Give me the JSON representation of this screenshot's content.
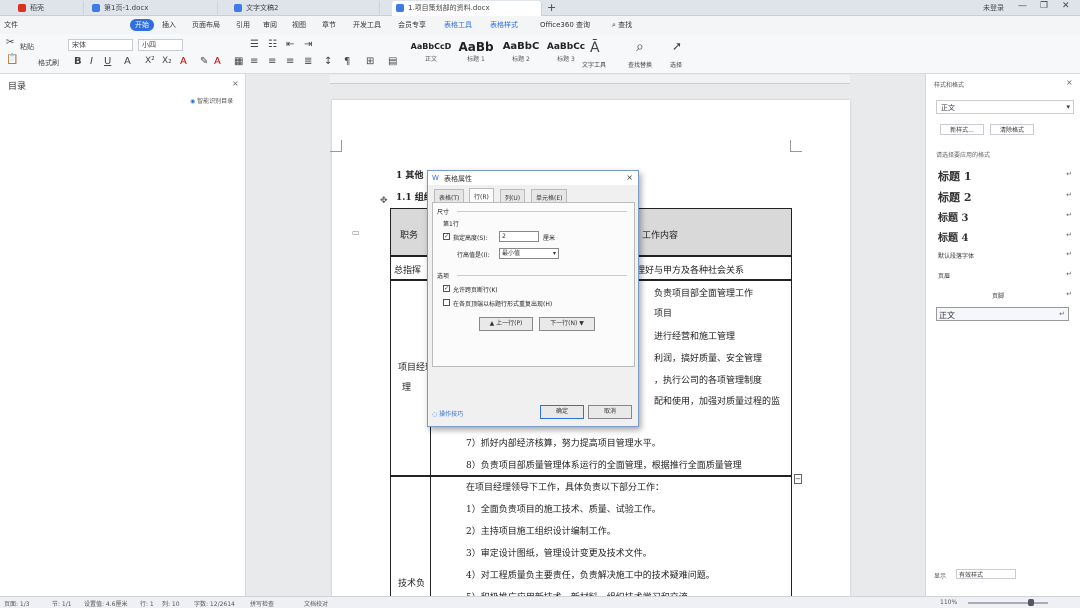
{
  "tabs": [
    {
      "label": "稻壳",
      "color": "#d9321f"
    },
    {
      "label": "第1页-1.docx",
      "color": "#3f7be5"
    },
    {
      "label": "文字文稿2",
      "color": "#3f7be5"
    },
    {
      "label": "1.项目策划部的资料.docx",
      "color": "#3f7be5"
    }
  ],
  "titlebar_right": {
    "login": "未登录",
    "share": "分享"
  },
  "menu": [
    "文件",
    "开始",
    "插入",
    "页面布局",
    "引用",
    "审阅",
    "视图",
    "章节",
    "开发工具",
    "会员专享",
    "表格工具",
    "表格样式",
    "Office360 查询",
    "查找"
  ],
  "menu_highlight": "开始",
  "toolbar": {
    "paste": "粘贴",
    "format_painter": "格式刷",
    "font": "宋体",
    "size": "小四",
    "styles": [
      {
        "sample": "AaBbCcD",
        "name": "正文"
      },
      {
        "sample": "AaBb",
        "name": "标题 1"
      },
      {
        "sample": "AaBbC",
        "name": "标题 2"
      },
      {
        "sample": "AaBbCc",
        "name": "标题 3"
      }
    ],
    "text_tools": "文字工具",
    "find_replace": "查找替换",
    "select": "选择"
  },
  "left_panel": {
    "title": "目录",
    "smart_toc": "智能识别目录"
  },
  "document": {
    "heading1": "1 其他",
    "heading2": "1.1 组织",
    "col_header_left": "职务",
    "col_header_right": "工作内容",
    "row1_left": "总指挥",
    "row1_right": "理好与甲方及各种社会关系",
    "row2_left": "项目经理",
    "row2_lines": [
      "负责项目部全面管理工作",
      "项目",
      "进行经营和施工管理",
      "利润，搞好质量、安全管理",
      "，执行公司的各项管理制度",
      "配和使用，加强对质量过程的监",
      "7）抓好内部经济核算，努力提高项目管理水平。",
      "8）负责项目部质量管理体系运行的全面管理，根据推行全面质量管理"
    ],
    "row3_left": "技术负",
    "row3_lines": [
      "在项目经理领导下工作，具体负责以下部分工作：",
      "1）全面负责项目的施工技术、质量、试验工作。",
      "2）主持项目施工组织设计编制工作。",
      "3）审定设计图纸，管理设计变更及技术文件。",
      "4）对工程质量负主要责任，负责解决施工中的技术疑难问题。",
      "5）积极推广应用新技术、新材料，组织技术学习和交流"
    ]
  },
  "dialog": {
    "title": "表格属性",
    "tabs": [
      "表格(T)",
      "行(R)",
      "列(U)",
      "单元格(E)"
    ],
    "active_tab": "行(R)",
    "section_size": "尺寸",
    "row_label": "第1行",
    "specify_height": "指定高度(S):",
    "height_value": "2",
    "height_unit": "厘米",
    "row_height_label": "行高值是(I):",
    "row_height_value": "最小值",
    "section_options": "选项",
    "allow_break": "允许跨页断行(K)",
    "repeat_header": "在各页顶端以标题行形式重复出现(H)",
    "prev_row": "▲ 上一行(P)",
    "next_row": "下一行(N) ▼",
    "tips": "操作技巧",
    "ok": "确定",
    "cancel": "取消"
  },
  "right_panel": {
    "title": "样式和格式",
    "current": "正文",
    "new_style": "新样式...",
    "clear_format": "清除格式",
    "apply_hint": "请选择要应用的格式",
    "styles": [
      "标题 1",
      "标题 2",
      "标题 3",
      "标题 4"
    ],
    "default_para_font": "默认段落字体",
    "page_header": "页眉",
    "footer_item": "页脚",
    "normal": "正文",
    "show_label": "显示",
    "show_value": "有效样式"
  },
  "statusbar": {
    "page": "页面: 1/3",
    "section": "节: 1/1",
    "setting": "设置值: 4.6厘米",
    "row": "行: 1",
    "col": "列: 10",
    "words": "字数: 12/2614",
    "spell": "拼写检查",
    "proof": "文档校对",
    "zoom": "110%"
  }
}
